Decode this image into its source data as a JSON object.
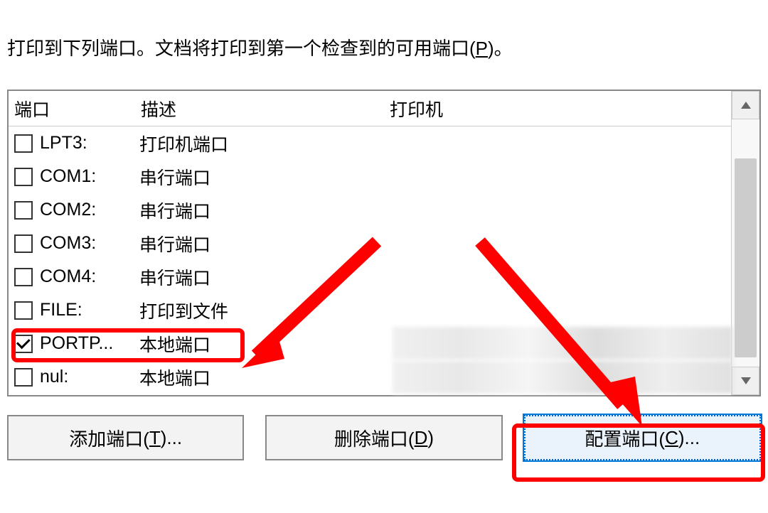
{
  "instruction": {
    "text_part1": "打印到下列端口。文档将打印到第一个检查到的可用端口(",
    "mnemonic": "P",
    "text_part2": ")。"
  },
  "table": {
    "headers": {
      "port": "端口",
      "description": "描述",
      "printer": "打印机"
    },
    "rows": [
      {
        "checked": false,
        "port": "LPT3:",
        "description": "打印机端口",
        "printer": ""
      },
      {
        "checked": false,
        "port": "COM1:",
        "description": "串行端口",
        "printer": ""
      },
      {
        "checked": false,
        "port": "COM2:",
        "description": "串行端口",
        "printer": ""
      },
      {
        "checked": false,
        "port": "COM3:",
        "description": "串行端口",
        "printer": ""
      },
      {
        "checked": false,
        "port": "COM4:",
        "description": "串行端口",
        "printer": ""
      },
      {
        "checked": false,
        "port": "FILE:",
        "description": "打印到文件",
        "printer": ""
      },
      {
        "checked": true,
        "port": "PORTP...",
        "description": "本地端口",
        "printer": ""
      },
      {
        "checked": false,
        "port": "nul:",
        "description": "本地端口",
        "printer": ""
      }
    ]
  },
  "buttons": {
    "add": {
      "pre": "添加端口(",
      "mnemonic": "T",
      "post": ")..."
    },
    "delete": {
      "pre": "删除端口(",
      "mnemonic": "D",
      "post": ")"
    },
    "config": {
      "pre": "配置端口(",
      "mnemonic": "C",
      "post": ")..."
    }
  }
}
